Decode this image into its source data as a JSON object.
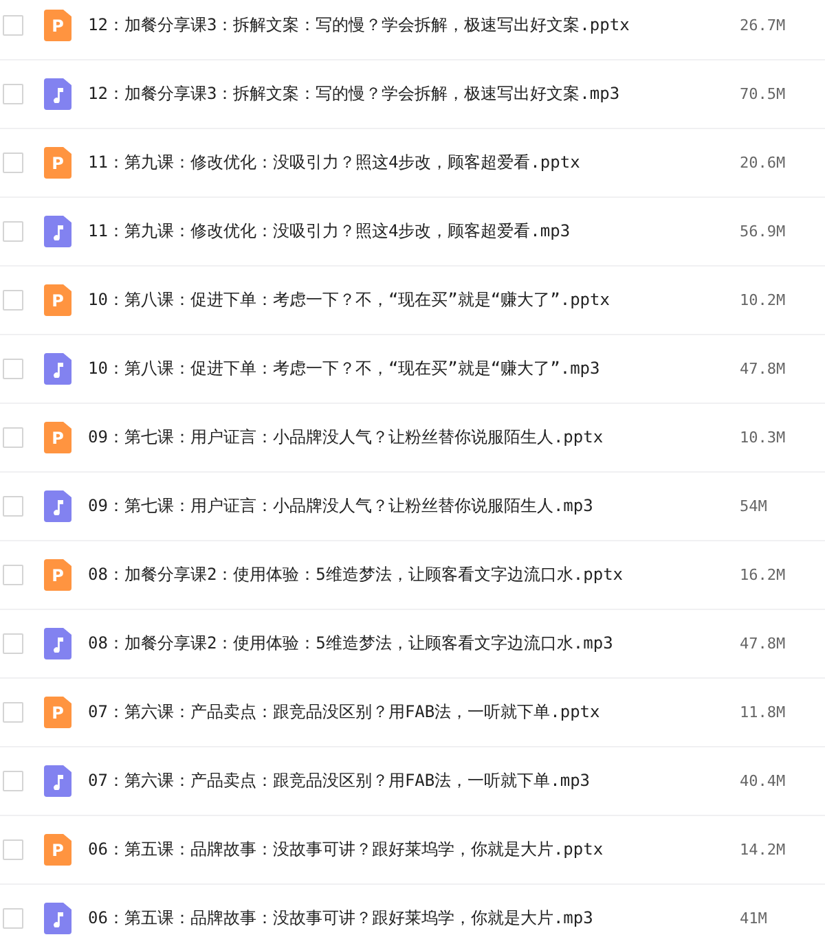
{
  "files": [
    {
      "kind": "pptx",
      "badge": "P",
      "name": "12：加餐分享课3：拆解文案：写的慢？学会拆解，极速写出好文案.pptx",
      "size": "26.7M",
      "checked": false
    },
    {
      "kind": "mp3",
      "name": "12：加餐分享课3：拆解文案：写的慢？学会拆解，极速写出好文案.mp3",
      "size": "70.5M",
      "checked": false
    },
    {
      "kind": "pptx",
      "badge": "P",
      "name": "11：第九课：修改优化：没吸引力？照这4步改，顾客超爱看.pptx",
      "size": "20.6M",
      "checked": false
    },
    {
      "kind": "mp3",
      "name": "11：第九课：修改优化：没吸引力？照这4步改，顾客超爱看.mp3",
      "size": "56.9M",
      "checked": false
    },
    {
      "kind": "pptx",
      "badge": "P",
      "name": "10：第八课：促进下单：考虑一下？不，“现在买”就是“赚大了”.pptx",
      "size": "10.2M",
      "checked": false
    },
    {
      "kind": "mp3",
      "name": "10：第八课：促进下单：考虑一下？不，“现在买”就是“赚大了”.mp3",
      "size": "47.8M",
      "checked": false
    },
    {
      "kind": "pptx",
      "badge": "P",
      "name": "09：第七课：用户证言：小品牌没人气？让粉丝替你说服陌生人.pptx",
      "size": "10.3M",
      "checked": false
    },
    {
      "kind": "mp3",
      "name": "09：第七课：用户证言：小品牌没人气？让粉丝替你说服陌生人.mp3",
      "size": "54M",
      "checked": false
    },
    {
      "kind": "pptx",
      "badge": "P",
      "name": "08：加餐分享课2：使用体验：5维造梦法，让顾客看文字边流口水.pptx",
      "size": "16.2M",
      "checked": false
    },
    {
      "kind": "mp3",
      "name": "08：加餐分享课2：使用体验：5维造梦法，让顾客看文字边流口水.mp3",
      "size": "47.8M",
      "checked": false
    },
    {
      "kind": "pptx",
      "badge": "P",
      "name": "07：第六课：产品卖点：跟竞品没区别？用FAB法，一听就下单.pptx",
      "size": "11.8M",
      "checked": false
    },
    {
      "kind": "mp3",
      "name": "07：第六课：产品卖点：跟竞品没区别？用FAB法，一听就下单.mp3",
      "size": "40.4M",
      "checked": false
    },
    {
      "kind": "pptx",
      "badge": "P",
      "name": "06：第五课：品牌故事：没故事可讲？跟好莱坞学，你就是大片.pptx",
      "size": "14.2M",
      "checked": false
    },
    {
      "kind": "mp3",
      "name": "06：第五课：品牌故事：没故事可讲？跟好莱坞学，你就是大片.mp3",
      "size": "41M",
      "checked": false
    }
  ]
}
